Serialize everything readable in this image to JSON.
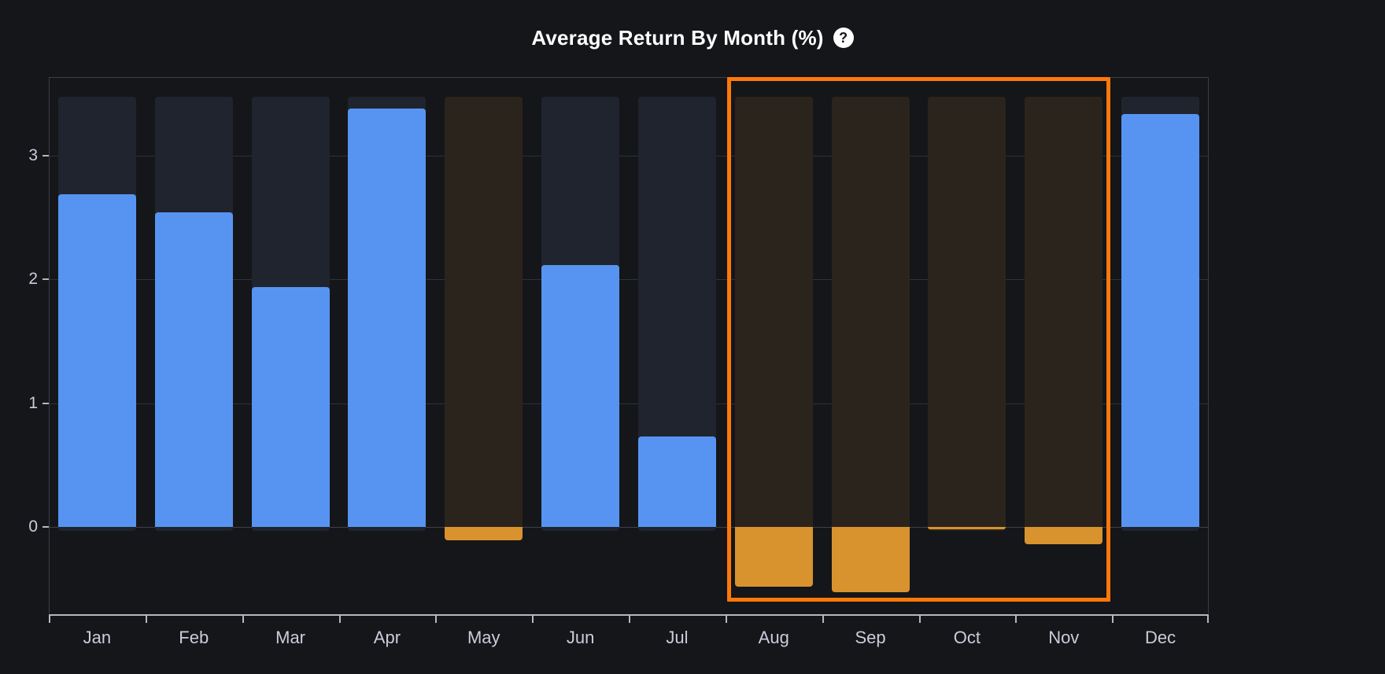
{
  "panel": {
    "title": "Average Return By Month (%)",
    "help_icon": "help-circle-icon",
    "help_glyph": "?",
    "background_color": "#141619"
  },
  "colors": {
    "positive_bar": "#5794f2",
    "negative_bar": "#d8922e",
    "highlight_border": "#ff780a",
    "column_background": "#1f242e",
    "column_background_negative": "#2b241c",
    "axis": "#b4b8bf",
    "grid": "#2e3338",
    "text": "#ccccdc"
  },
  "highlight": {
    "name": "selected-months-highlight",
    "from": "Aug",
    "to": "Nov",
    "border_color": "#ff780a"
  },
  "chart_data": {
    "type": "bar",
    "title": "Average Return By Month (%)",
    "xlabel": "",
    "ylabel": "",
    "categories": [
      "Jan",
      "Feb",
      "Mar",
      "Apr",
      "May",
      "Jun",
      "Jul",
      "Aug",
      "Sep",
      "Oct",
      "Nov",
      "Dec"
    ],
    "values": [
      2.69,
      2.54,
      1.94,
      3.38,
      -0.11,
      2.12,
      0.73,
      -0.48,
      -0.53,
      -0.01,
      -0.14,
      3.34
    ],
    "ylim": [
      -0.6,
      3.5
    ],
    "yticks": [
      0,
      1,
      2,
      3
    ],
    "ytick_labels": [
      "0",
      "1",
      "2",
      "3"
    ],
    "grid": true,
    "legend": false,
    "bar_colors": [
      "#5794f2",
      "#5794f2",
      "#5794f2",
      "#5794f2",
      "#d8922e",
      "#5794f2",
      "#5794f2",
      "#d8922e",
      "#d8922e",
      "#d8922e",
      "#d8922e",
      "#5794f2"
    ],
    "highlighted_categories": [
      "Aug",
      "Sep",
      "Oct",
      "Nov"
    ]
  }
}
